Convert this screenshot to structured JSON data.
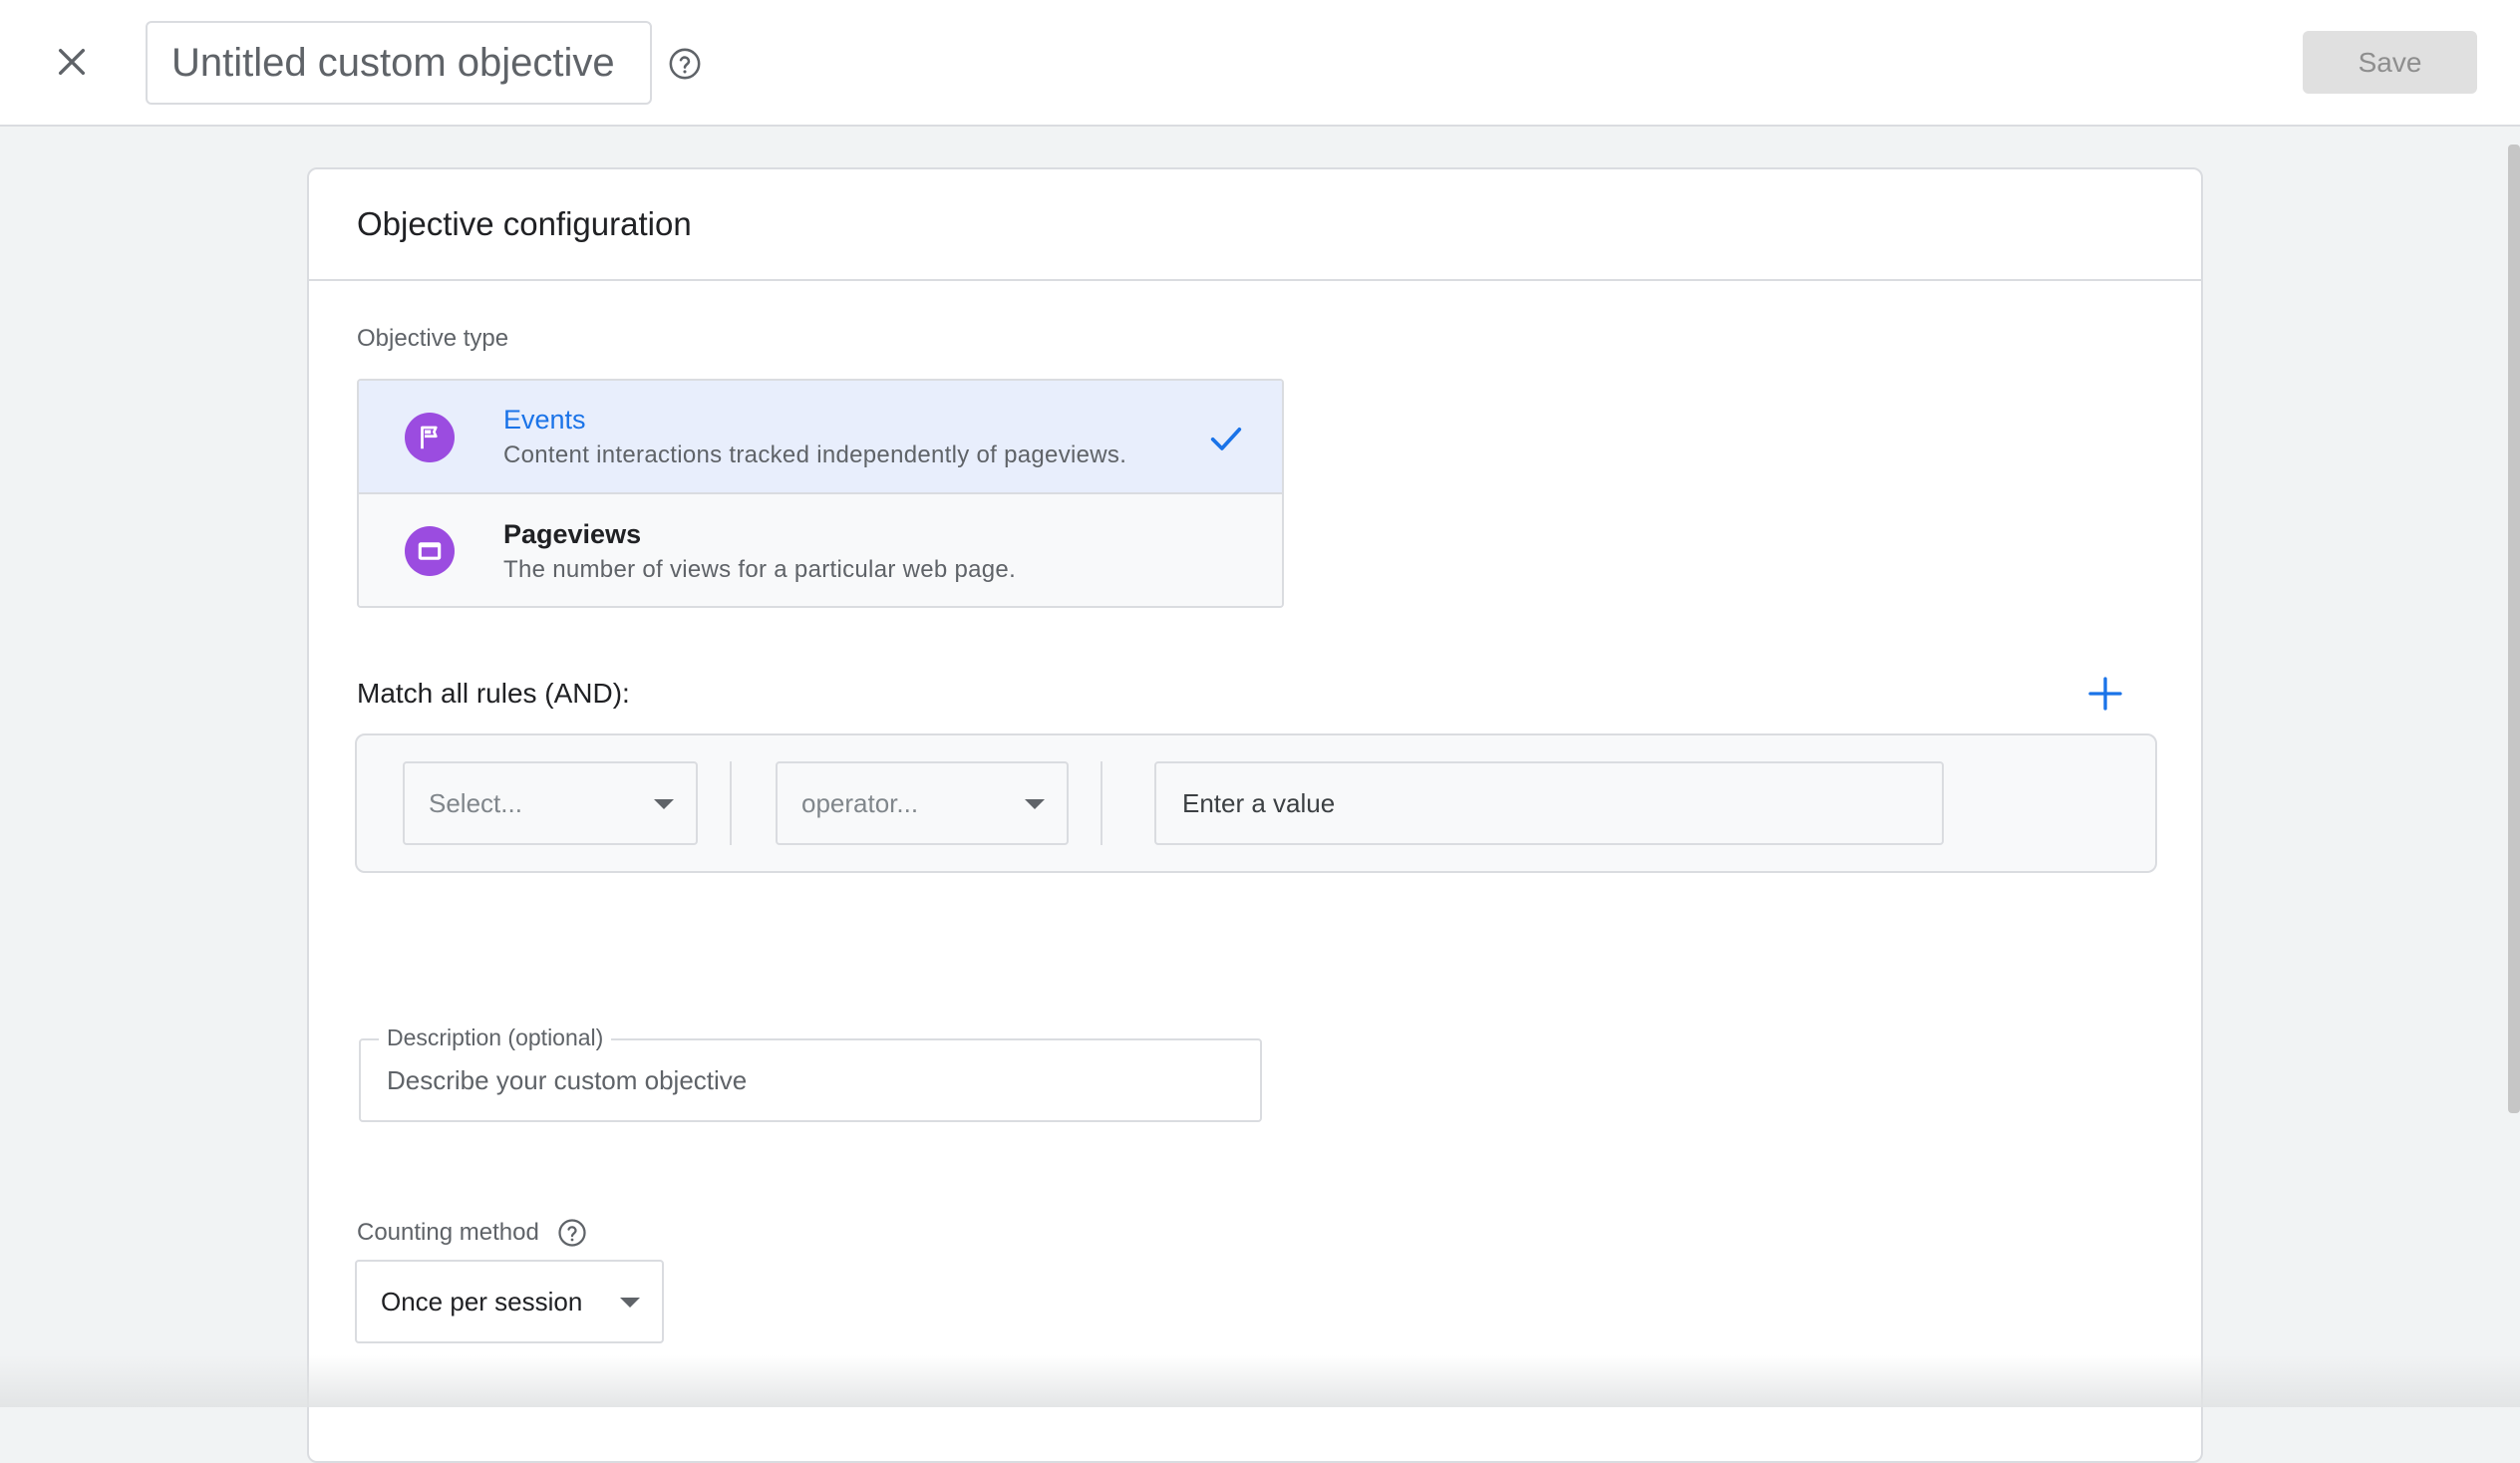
{
  "header": {
    "title": "Untitled custom objective",
    "save_label": "Save"
  },
  "card": {
    "heading": "Objective configuration",
    "objective_type_label": "Objective type",
    "types": [
      {
        "title": "Events",
        "description": "Content interactions tracked independently of pageviews.",
        "icon": "flag-icon",
        "selected": true
      },
      {
        "title": "Pageviews",
        "description": "The number of views for a particular web page.",
        "icon": "window-icon",
        "selected": false
      }
    ],
    "rules_label": "Match all rules (AND):",
    "rule": {
      "field_placeholder": "Select...",
      "operator_placeholder": "operator...",
      "value_placeholder": "Enter a value"
    },
    "description": {
      "legend": "Description (optional)",
      "placeholder": "Describe your custom objective"
    },
    "counting": {
      "label": "Counting method",
      "value": "Once per session"
    }
  },
  "colors": {
    "accent": "#1a73e8",
    "icon_purple": "#9b4ce0",
    "selected_bg": "#e8eefc"
  }
}
